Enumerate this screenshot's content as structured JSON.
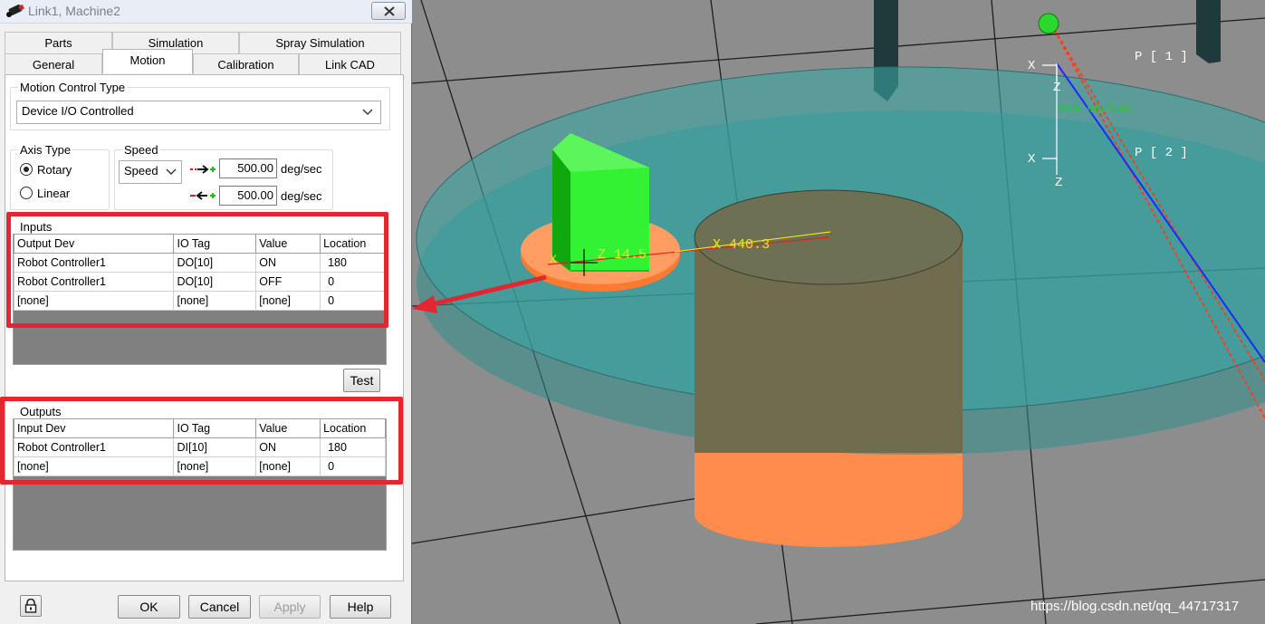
{
  "window": {
    "title": "Link1, Machine2"
  },
  "tabs": {
    "row1": [
      {
        "label": "Parts"
      },
      {
        "label": "Simulation"
      },
      {
        "label": "Spray Simulation"
      }
    ],
    "row2": [
      {
        "label": "General"
      },
      {
        "label": "Motion",
        "active": true
      },
      {
        "label": "Calibration"
      },
      {
        "label": "Link CAD"
      }
    ]
  },
  "motion_control": {
    "group_label": "Motion Control Type",
    "value": "Device I/O Controlled"
  },
  "axis_type": {
    "group_label": "Axis Type",
    "options": [
      {
        "label": "Rotary",
        "selected": true
      },
      {
        "label": "Linear",
        "selected": false
      }
    ]
  },
  "speed": {
    "group_label": "Speed",
    "mode": "Speed",
    "forward_value": "500.00",
    "reverse_value": "500.00",
    "unit": "deg/sec"
  },
  "inputs": {
    "group_label": "Inputs",
    "columns": [
      "Output Dev",
      "IO Tag",
      "Value",
      "Location"
    ],
    "rows": [
      [
        "Robot Controller1",
        "DO[10]",
        "ON",
        "180"
      ],
      [
        "Robot Controller1",
        "DO[10]",
        "OFF",
        "0"
      ],
      [
        "[none]",
        "[none]",
        "[none]",
        "0"
      ]
    ]
  },
  "test_button": "Test",
  "outputs": {
    "group_label": "Outputs",
    "columns": [
      "Input Dev",
      "IO Tag",
      "Value",
      "Location"
    ],
    "rows": [
      [
        "Robot Controller1",
        "DI[10]",
        "ON",
        "180"
      ],
      [
        "[none]",
        "[none]",
        "[none]",
        "0"
      ]
    ]
  },
  "footer": {
    "ok": "OK",
    "cancel": "Cancel",
    "apply": "Apply",
    "help": "Help"
  },
  "viewport": {
    "labels": {
      "x_dimension": "X 440.3",
      "z_dimension": "Z 14.5",
      "p1": "P [ 1 ]",
      "p2": "P [ 2 ]",
      "speed_overlay": "300 mm/sec",
      "axis_x": "X",
      "axis_z": "Z"
    },
    "colors": {
      "floor": "#8d8d8d",
      "turntable": "#3a8f8e",
      "pedestal": "#ff8c4c",
      "part": "#20e020",
      "path_red": "#ff3b20",
      "path_blue": "#1a2cff",
      "annotation": "#e3262f"
    }
  },
  "watermark": "https://blog.csdn.net/qq_44717317"
}
